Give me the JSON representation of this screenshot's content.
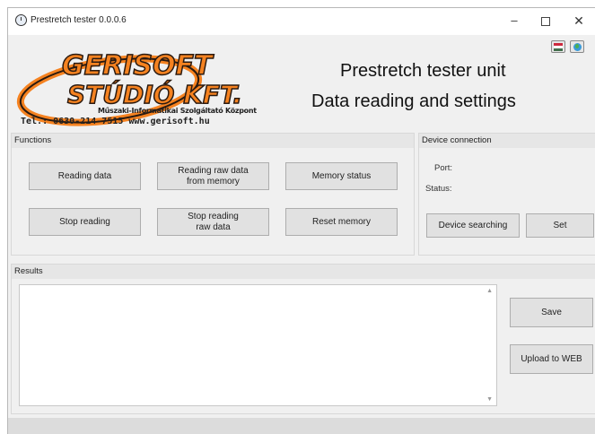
{
  "window": {
    "title": "Prestretch tester 0.0.0.6",
    "minimize": "–",
    "close": "✕"
  },
  "logo": {
    "line1": "GERISOFT",
    "line2": "STÚDIÓ KFT.",
    "sub1": "Műszaki-Informatikai Szolgáltató Központ",
    "sub2": "Tel.: 0630-214-7515   www.gerisoft.hu",
    "colors": {
      "orange": "#f58220",
      "dark": "#2a1a10"
    }
  },
  "header": {
    "line1": "Prestretch tester unit",
    "line2": "Data reading and settings"
  },
  "language_icons": [
    "hungarian-flag-icon",
    "globe-icon"
  ],
  "functions": {
    "title": "Functions",
    "buttons": {
      "reading_data": "Reading data",
      "reading_raw_1": "Reading raw data",
      "reading_raw_2": "from memory",
      "memory_status": "Memory status",
      "stop_reading": "Stop reading",
      "stop_raw_1": "Stop reading",
      "stop_raw_2": "raw data",
      "reset_memory": "Reset memory"
    }
  },
  "device": {
    "title": "Device connection",
    "port_label": "Port:",
    "status_label": "Status:",
    "searching_button": "Device searching",
    "set_button": "Set"
  },
  "results": {
    "title": "Results",
    "save_button": "Save",
    "upload_button": "Upload to WEB"
  }
}
